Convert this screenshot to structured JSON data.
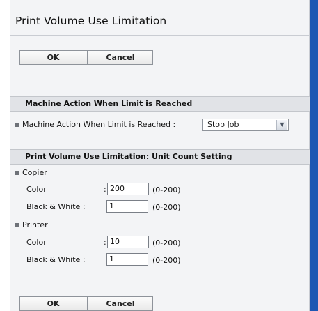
{
  "page": {
    "title": "Print Volume Use Limitation"
  },
  "buttons": {
    "ok_label": "OK",
    "cancel_label": "Cancel"
  },
  "machine_action_section": {
    "heading": "Machine Action When Limit is Reached",
    "field_label": "Machine Action When Limit is Reached :",
    "selected_value": "Stop Job"
  },
  "unit_count_section": {
    "heading": "Print Volume Use Limitation: Unit Count Setting",
    "copier": {
      "label": "Copier",
      "color_label": "Color",
      "color_value": "200",
      "color_range": "(0-200)",
      "bw_label": "Black & White :",
      "bw_value": "1",
      "bw_range": "(0-200)"
    },
    "printer": {
      "label": "Printer",
      "color_label": "Color",
      "color_value": "10",
      "color_range": "(0-200)",
      "bw_label": "Black & White :",
      "bw_value": "1",
      "bw_range": "(0-200)"
    }
  },
  "colors": {
    "accent_strip": "#1d57b3",
    "section_bg": "#e1e3e7",
    "panel_bg": "#f3f4f6"
  },
  "icons": {
    "dropdown": "chevron-down-icon",
    "bullet": "square-bullet-icon"
  }
}
